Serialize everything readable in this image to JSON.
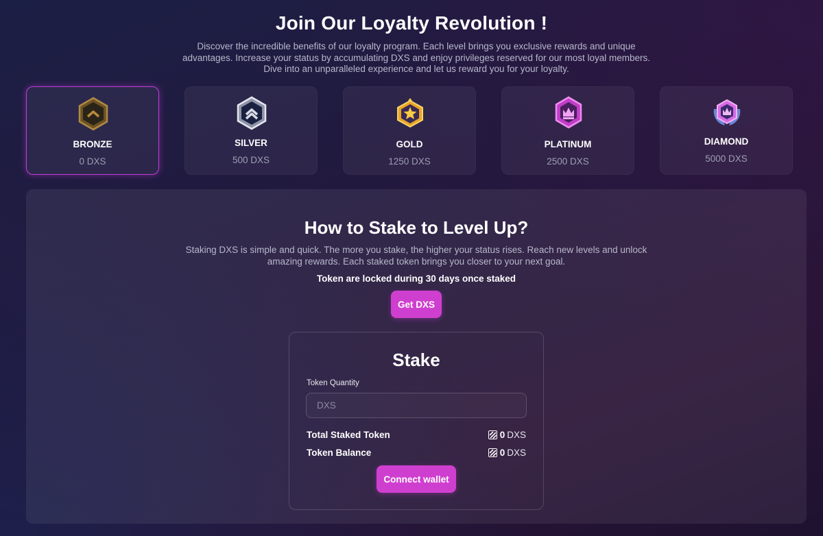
{
  "hero": {
    "title": "Join Our Loyalty Revolution !",
    "description": "Discover the incredible benefits of our loyalty program. Each level brings you exclusive rewards and unique advantages. Increase your status by accumulating DXS and enjoy privileges reserved for our most loyal members. Dive into an unparalleled experience and let us reward you for your loyalty."
  },
  "tiers": [
    {
      "name": "BRONZE",
      "value": "0 DXS",
      "icon": "bronze-chevron-badge",
      "color": "#8a6a2e",
      "active": true
    },
    {
      "name": "SILVER",
      "value": "500 DXS",
      "icon": "silver-chevron-badge",
      "color": "#c9ccd8",
      "active": false
    },
    {
      "name": "GOLD",
      "value": "1250 DXS",
      "icon": "gold-star-badge",
      "color": "#f3b52f",
      "active": false
    },
    {
      "name": "PLATINUM",
      "value": "2500 DXS",
      "icon": "platinum-crown-badge",
      "color": "#d44ed8",
      "active": false
    },
    {
      "name": "DIAMOND",
      "value": "5000 DXS",
      "icon": "diamond-winged-badge",
      "color": "#d86ae8",
      "active": false
    }
  ],
  "stake_section": {
    "title": "How to Stake to Level Up?",
    "description": "Staking DXS is simple and quick. The more you stake, the higher your status rises. Reach new levels and unlock amazing rewards. Each staked token brings you closer to your next goal.",
    "note": "Token are locked during 30 days once staked",
    "get_button": "Get DXS"
  },
  "stake_card": {
    "title": "Stake",
    "quantity_label": "Token Quantity",
    "quantity_placeholder": "DXS",
    "quantity_value": "",
    "rows": [
      {
        "label": "Total Staked Token",
        "amount": "0",
        "unit": "DXS",
        "icon": "dxs-token-icon"
      },
      {
        "label": "Token Balance",
        "amount": "0",
        "unit": "DXS",
        "icon": "dxs-token-icon"
      }
    ],
    "connect_button": "Connect wallet"
  },
  "colors": {
    "accent": "#cf3fcf",
    "active_border": "#c03fd6",
    "muted_text": "#9e9eb4"
  }
}
